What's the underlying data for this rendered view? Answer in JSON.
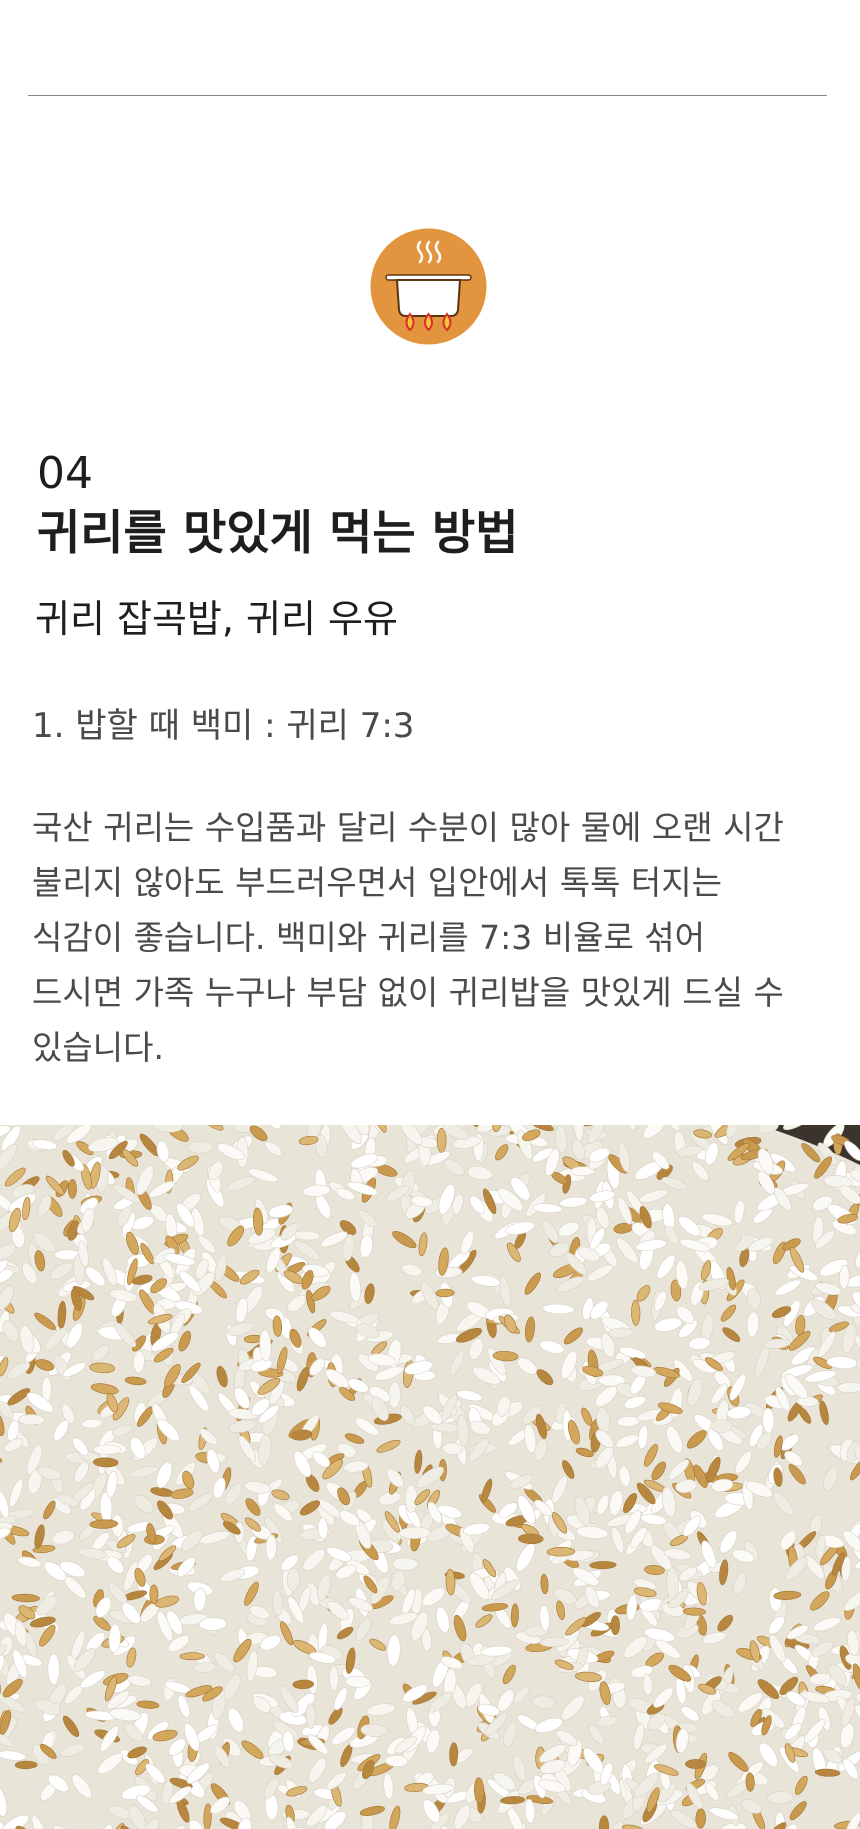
{
  "section": {
    "number": "04",
    "title": "귀리를 맛있게 먹는 방법",
    "subtitle": "귀리 잡곡밥, 귀리 우유",
    "ratio": "1. 밥할 때 백미 : 귀리 7:3",
    "description_lines": [
      "국산 귀리는 수입품과 달리 수분이 많아 물에 오랜 시간",
      "불리지 않아도 부드러우면서 입안에서 톡톡 터지는",
      "식감이 좋습니다. 백미와 귀리를 7:3 비율로 섞어",
      "드시면 가족 누구나 부담 없이 귀리밥을 맛있게 드실 수",
      "있습니다."
    ]
  },
  "icon": {
    "name": "cooking-pot-icon",
    "accent_color": "#e2943e"
  },
  "photo": {
    "subject": "oat-rice-photo"
  }
}
